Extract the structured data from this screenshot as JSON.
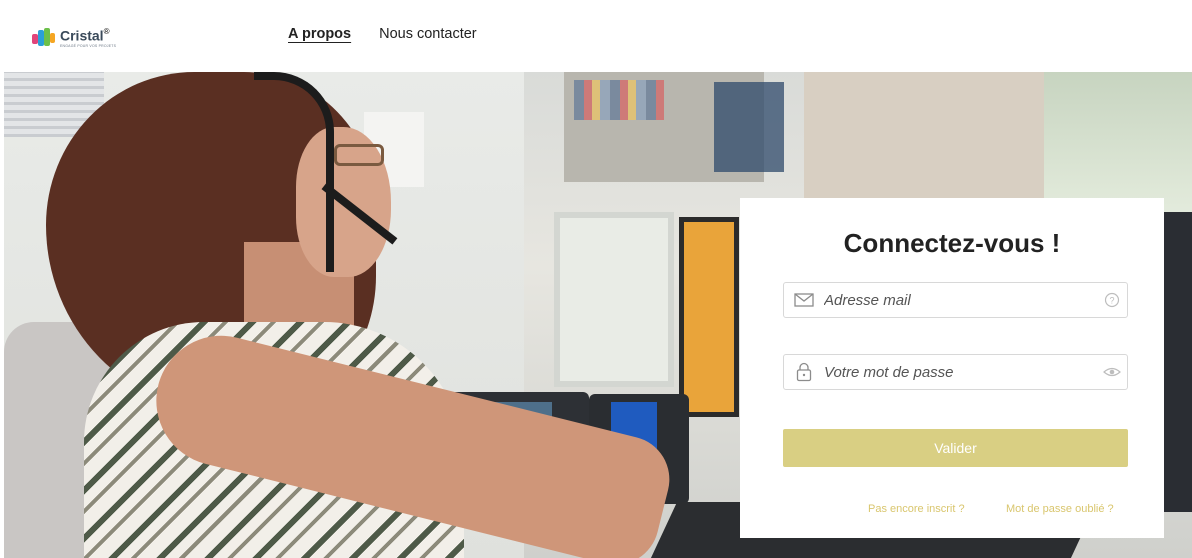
{
  "header": {
    "logo": {
      "name": "Cristal",
      "sup": "®",
      "tagline": "ENGAGÉ POUR VOS PROJETS"
    },
    "nav": [
      {
        "label": "A propos",
        "active": true
      },
      {
        "label": "Nous contacter",
        "active": false
      }
    ]
  },
  "login": {
    "title": "Connectez-vous !",
    "email": {
      "placeholder": "Adresse mail",
      "icon": "envelope-icon",
      "trailing_icon": "help-circle-icon"
    },
    "password": {
      "placeholder": "Votre mot de passe",
      "icon": "lock-icon",
      "trailing_icon": "eye-icon"
    },
    "submit_label": "Valider",
    "register_link": "Pas encore inscrit ?",
    "forgot_link": "Mot de passe oublié ?"
  },
  "colors": {
    "accent": "#d9cf83",
    "link": "#d9c66e",
    "title": "#222222"
  }
}
